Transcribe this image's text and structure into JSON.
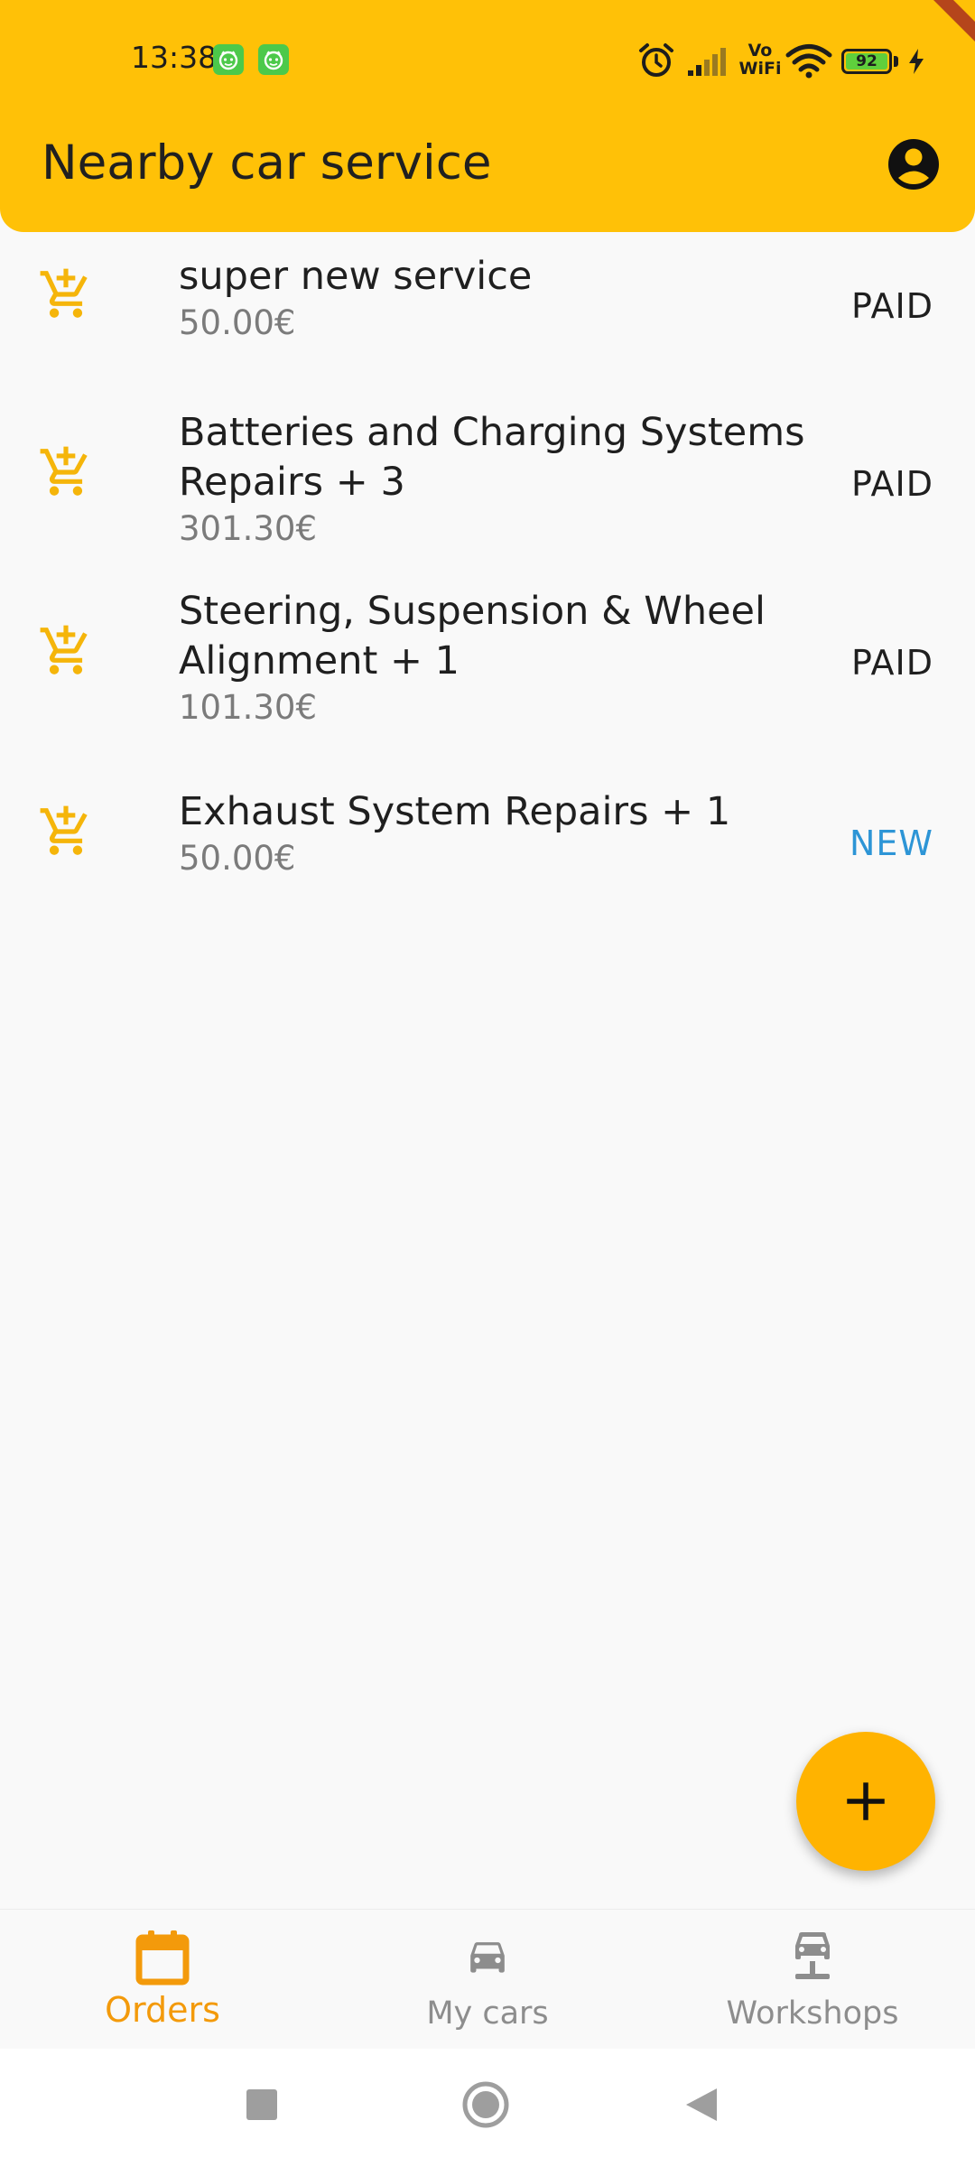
{
  "status_bar": {
    "time": "13:38",
    "vowifi_line1": "Vo",
    "vowifi_line2": "WiFi",
    "battery_level": "92",
    "icons": [
      "notification-app-icon",
      "notification-app-icon",
      "alarm-icon",
      "signal-icon",
      "vowifi-icon",
      "wifi-icon",
      "battery-icon",
      "charging-icon"
    ]
  },
  "header": {
    "title": "Nearby car service",
    "account_icon": "account-circle-icon"
  },
  "orders": [
    {
      "title": "super new service",
      "price": "50.00€",
      "status": "PAID",
      "icon": "add-shopping-cart-icon"
    },
    {
      "title": "Batteries and Charging Systems Repairs + 3",
      "price": "301.30€",
      "status": "PAID",
      "icon": "add-shopping-cart-icon"
    },
    {
      "title": "Steering, Suspension & Wheel Alignment + 1",
      "price": "101.30€",
      "status": "PAID",
      "icon": "add-shopping-cart-icon"
    },
    {
      "title": "Exhaust System Repairs + 1",
      "price": "50.00€",
      "status": "NEW",
      "icon": "add-shopping-cart-icon"
    }
  ],
  "fab": {
    "icon": "plus-icon"
  },
  "bottom_nav": {
    "items": [
      {
        "label": "Orders",
        "icon": "calendar-icon",
        "active": true
      },
      {
        "label": "My cars",
        "icon": "car-icon",
        "active": false
      },
      {
        "label": "Workshops",
        "icon": "car-lift-icon",
        "active": false
      }
    ]
  },
  "system_nav": {
    "icons": [
      "recents-icon",
      "home-icon",
      "back-icon"
    ]
  },
  "colors": {
    "primary": "#ffc107",
    "fab": "#ffb300",
    "active_nav": "#f39a0b",
    "status_new": "#2d95d6",
    "cart_icon": "#f5b50a",
    "background": "#f9f9f9"
  }
}
